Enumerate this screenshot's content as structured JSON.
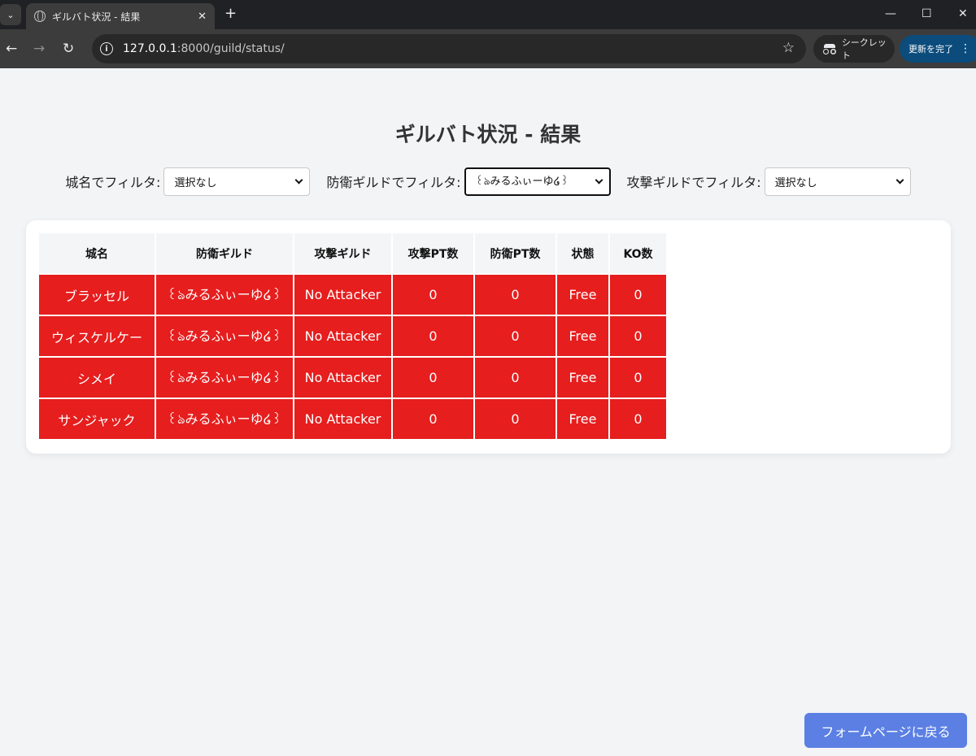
{
  "browser": {
    "tab_title": "ギルバト状況 - 結果",
    "url_host": "127.0.0.1",
    "url_rest": ":8000/guild/status/",
    "incognito_label": "シークレット",
    "update_label": "更新を完了",
    "icons": [
      "tab-list-icon",
      "globe-icon",
      "close-icon",
      "plus-icon",
      "minimize-icon",
      "maximize-icon",
      "window-close-icon",
      "back-arrow-icon",
      "forward-arrow-icon",
      "reload-icon",
      "site-info-icon",
      "bookmark-star-icon",
      "incognito-icon",
      "more-menu-icon"
    ]
  },
  "page": {
    "title": "ギルバト状況 - 結果",
    "filters": [
      {
        "label": "城名でフィルタ:",
        "selected": "選択なし"
      },
      {
        "label": "防衛ギルドでフィルタ:",
        "selected": "꒰ঌみるふぃーゆ໒꒱"
      },
      {
        "label": "攻撃ギルドでフィルタ:",
        "selected": "選択なし"
      }
    ],
    "table": {
      "headers": [
        "城名",
        "防衛ギルド",
        "攻撃ギルド",
        "攻撃PT数",
        "防衛PT数",
        "状態",
        "KO数"
      ],
      "rows": [
        [
          "ブラッセル",
          "꒰ঌみるふぃーゆ໒꒱",
          "No Attacker",
          "0",
          "0",
          "Free",
          "0"
        ],
        [
          "ウィスケルケー",
          "꒰ঌみるふぃーゆ໒꒱",
          "No Attacker",
          "0",
          "0",
          "Free",
          "0"
        ],
        [
          "シメイ",
          "꒰ঌみるふぃーゆ໒꒱",
          "No Attacker",
          "0",
          "0",
          "Free",
          "0"
        ],
        [
          "サンジャック",
          "꒰ঌみるふぃーゆ໒꒱",
          "No Attacker",
          "0",
          "0",
          "Free",
          "0"
        ]
      ]
    },
    "back_button": "フォームページに戻る"
  },
  "colors": {
    "row_bg": "#e61e1e",
    "button_bg": "#5b7fe3",
    "page_bg": "#f3f4f6"
  }
}
